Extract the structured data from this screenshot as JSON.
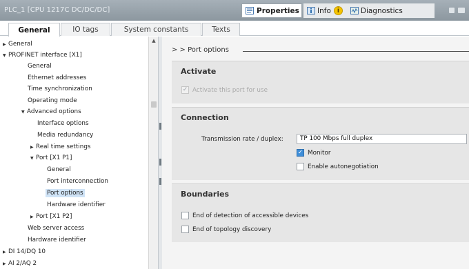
{
  "window": {
    "title": "PLC_1 [CPU 1217C DC/DC/DC]",
    "tabs": {
      "properties": "Properties",
      "info": "Info",
      "diagnostics": "Diagnostics"
    }
  },
  "editor_tabs": [
    "General",
    "IO tags",
    "System constants",
    "Texts"
  ],
  "tree": {
    "items": [
      {
        "label": "General"
      },
      {
        "label": "PROFINET interface [X1]"
      },
      {
        "label": "General"
      },
      {
        "label": "Ethernet addresses"
      },
      {
        "label": "Time synchronization"
      },
      {
        "label": "Operating mode"
      },
      {
        "label": "Advanced options"
      },
      {
        "label": "Interface options"
      },
      {
        "label": "Media redundancy"
      },
      {
        "label": "Real time settings"
      },
      {
        "label": "Port [X1 P1]"
      },
      {
        "label": "General"
      },
      {
        "label": "Port interconnection"
      },
      {
        "label": "Port options"
      },
      {
        "label": "Hardware identifier"
      },
      {
        "label": "Port [X1 P2]"
      },
      {
        "label": "Web server access"
      },
      {
        "label": "Hardware identifier"
      },
      {
        "label": "DI 14/DQ 10"
      },
      {
        "label": "AI 2/AQ 2"
      }
    ]
  },
  "content": {
    "breadcrumb": "> >   Port options",
    "activate": {
      "heading": "Activate",
      "checkbox_label": "Activate this port for use"
    },
    "connection": {
      "heading": "Connection",
      "rate_label": "Transmission rate / duplex:",
      "rate_value": "TP 100 Mbps full duplex",
      "monitor_label": "Monitor",
      "autoneg_label": "Enable autonegotiation"
    },
    "boundaries": {
      "heading": "Boundaries",
      "end_detection_label": "End of detection of accessible devices",
      "end_topology_label": "End of topology discovery"
    }
  },
  "colors": {
    "titlebar": "#8c979f",
    "selected": "#cfe3f6",
    "section_bg": "#e6e6e6",
    "checkbox_checked": "#3f8ed8",
    "warning": "#f5c400"
  }
}
